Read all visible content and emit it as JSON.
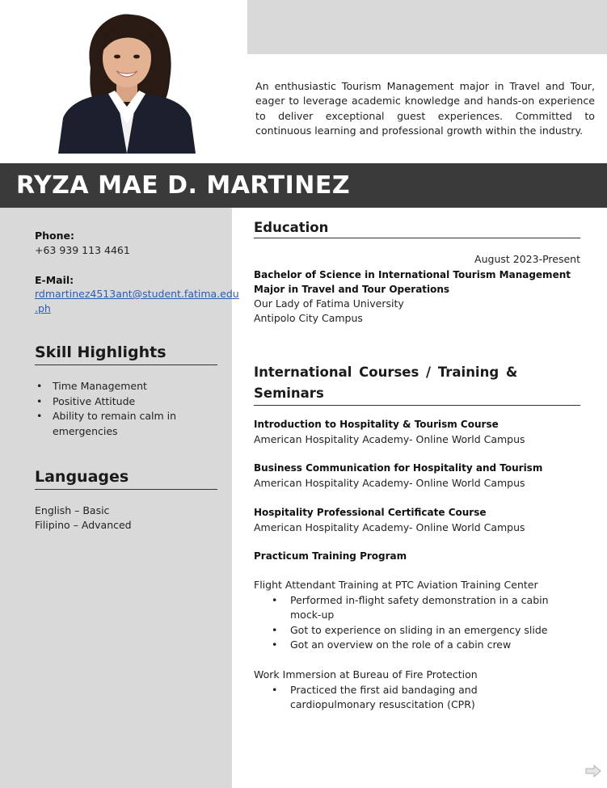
{
  "header": {
    "name": "RYZA MAE D. MARTINEZ",
    "summary": "An enthusiastic Tourism Management major in Travel and Tour, eager to leverage academic knowledge and hands-on experience to deliver exceptional guest experiences. Committed to continuous learning and professional growth within the industry."
  },
  "sidebar": {
    "phone_label": "Phone:",
    "phone_value": "+63 939 113 4461",
    "email_label": "E-Mail:",
    "email_line1": "rdmartinez4513ant@student.fatima.edu",
    "email_line2": ".ph",
    "skills_heading": "Skill Highlights",
    "skills": [
      "Time Management",
      "Positive Attitude",
      "Ability to remain calm in emergencies"
    ],
    "languages_heading": "Languages",
    "languages": [
      "English – Basic",
      "Filipino – Advanced"
    ]
  },
  "education": {
    "heading": "Education",
    "date": "August 2023-Present",
    "degree": "Bachelor of Science in International Tourism Management Major in Travel and Tour Operations",
    "school": "Our Lady of Fatima University",
    "campus": "Antipolo City Campus"
  },
  "courses": {
    "heading_line1": "International Courses / Training &",
    "heading_line2": "Seminars",
    "items": [
      {
        "title": "Introduction to Hospitality & Tourism Course",
        "org": "American Hospitality Academy- Online World Campus"
      },
      {
        "title": "Business Communication for Hospitality and Tourism",
        "org": "American Hospitality Academy- Online World Campus"
      },
      {
        "title": "Hospitality Professional Certificate Course",
        "org": "American Hospitality Academy- Online World Campus"
      }
    ],
    "practicum_title": "Practicum Training Program",
    "flight": {
      "title": "Flight Attendant Training at PTC Aviation Training Center",
      "bullets": [
        "Performed in-flight safety demonstration in a cabin mock-up",
        "Got to experience on sliding in an emergency slide",
        "Got an overview on the role of a cabin crew"
      ]
    },
    "immersion": {
      "title": "Work Immersion at Bureau of Fire Protection",
      "bullets": [
        "Practiced the first aid bandaging and cardiopulmonary resuscitation (CPR)"
      ]
    }
  },
  "icons": {
    "next_page": "arrow-right-icon"
  }
}
